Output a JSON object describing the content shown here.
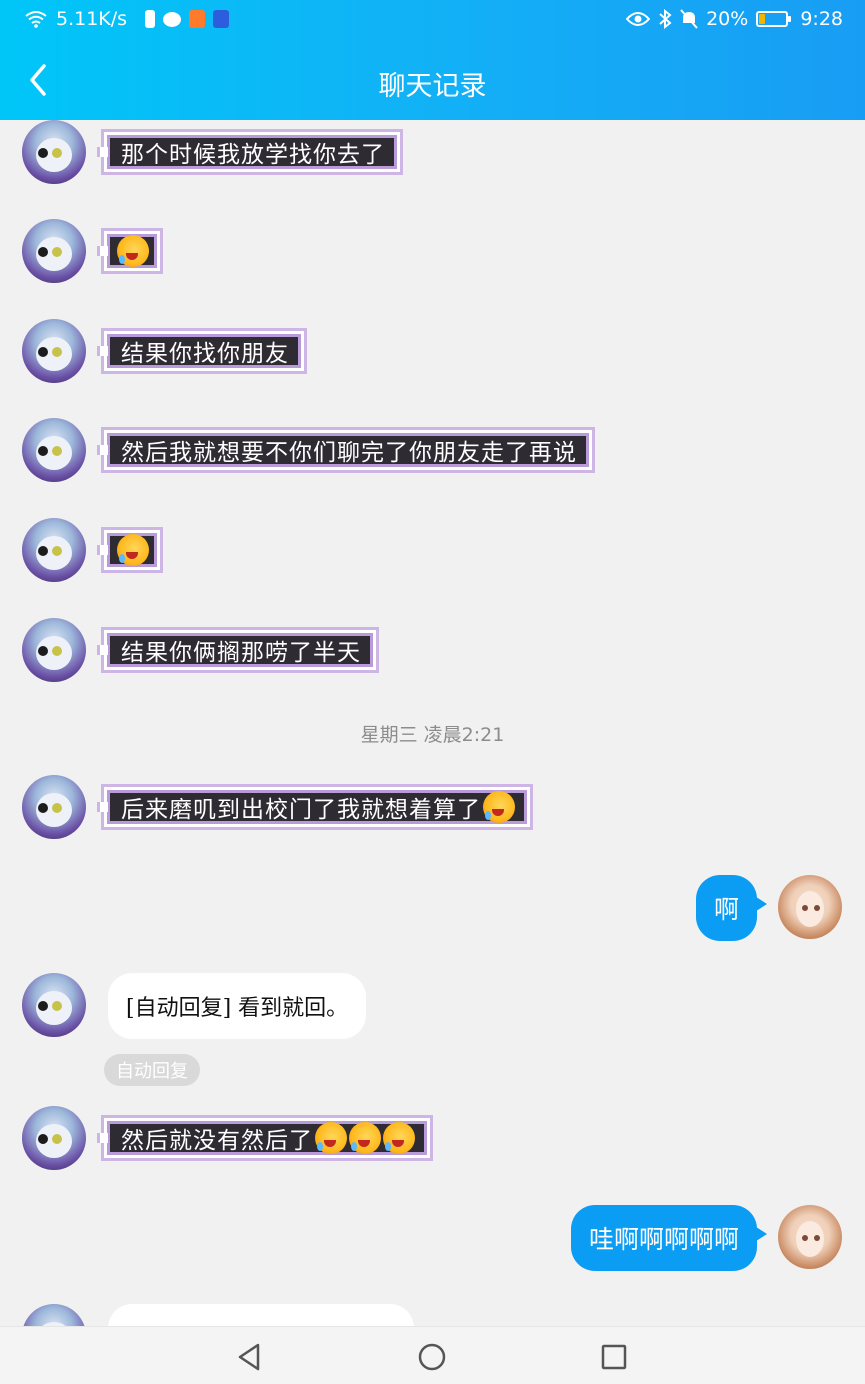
{
  "status_bar": {
    "network_speed": "5.11K/s",
    "battery_percent": "20%",
    "time": "9:28",
    "icons": [
      "wifi-icon",
      "battery-saver-icon",
      "wechat-icon",
      "app-orange-icon",
      "app-blue-icon",
      "eye-icon",
      "bluetooth-icon",
      "mute-icon",
      "battery-icon"
    ]
  },
  "header": {
    "title": "聊天记录",
    "back_icon": "chevron-left-icon"
  },
  "messages": [
    {
      "side": "left",
      "style": "pixel",
      "text": "那个时候我放学找你去了",
      "emoji_count": 0
    },
    {
      "side": "left",
      "style": "pixel",
      "text": "",
      "emoji_count": 1
    },
    {
      "side": "left",
      "style": "pixel",
      "text": "结果你找你朋友",
      "emoji_count": 0
    },
    {
      "side": "left",
      "style": "pixel",
      "text": "然后我就想要不你们聊完了你朋友走了再说",
      "emoji_count": 0
    },
    {
      "side": "left",
      "style": "pixel",
      "text": "",
      "emoji_count": 1
    },
    {
      "side": "left",
      "style": "pixel",
      "text": "结果你俩搁那唠了半天",
      "emoji_count": 0
    },
    {
      "side": "left",
      "style": "pixel",
      "text": "后来磨叽到出校门了我就想着算了",
      "emoji_count": 1
    },
    {
      "side": "right",
      "style": "blue",
      "text": "啊"
    },
    {
      "side": "left",
      "style": "white",
      "text": "[自动回复] 看到就回。",
      "tag": "自动回复"
    },
    {
      "side": "left",
      "style": "pixel",
      "text": "然后就没有然后了",
      "emoji_count": 3
    },
    {
      "side": "right",
      "style": "blue",
      "text": "哇啊啊啊啊啊"
    }
  ],
  "timestamp": "星期三 凌晨2:21",
  "bottom_nav": {
    "icons": [
      "back-triangle-icon",
      "home-circle-icon",
      "recents-square-icon"
    ]
  },
  "colors": {
    "header_start": "#00c6f8",
    "header_end": "#189df4",
    "blue_bubble": "#0b9cf3",
    "pixel_bubble_bg": "#2e2b33",
    "pixel_bubble_border": "#b89bd8",
    "chat_bg": "#f1f1f1"
  }
}
